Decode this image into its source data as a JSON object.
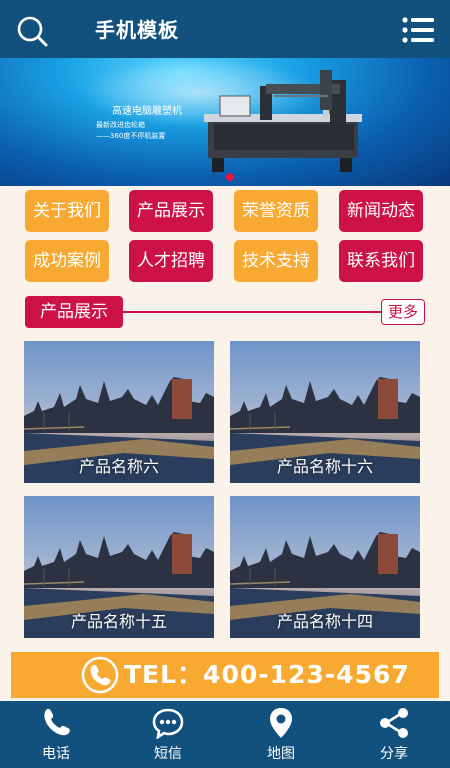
{
  "header": {
    "title": "手机模板",
    "search_icon": "search-icon",
    "menu_icon": "menu-icon"
  },
  "banner": {
    "line1": "高速电脑雕塑机",
    "line2": "最新改进齿轮箱",
    "line3": "——360度不停机装置",
    "slides": 2,
    "active_slide": 2
  },
  "nav": [
    {
      "label": "关于我们",
      "color": "#f8a932"
    },
    {
      "label": "产品展示",
      "color": "#cc1246"
    },
    {
      "label": "荣誉资质",
      "color": "#f8a932"
    },
    {
      "label": "新闻动态",
      "color": "#cc1246"
    },
    {
      "label": "成功案例",
      "color": "#f8a932"
    },
    {
      "label": "人才招聘",
      "color": "#cc1246"
    },
    {
      "label": "技术支持",
      "color": "#f8a932"
    },
    {
      "label": "联系我们",
      "color": "#cc1246"
    }
  ],
  "section": {
    "title": "产品展示",
    "more": "更多"
  },
  "products": [
    {
      "name": "产品名称六"
    },
    {
      "name": "产品名称十六"
    },
    {
      "name": "产品名称十五"
    },
    {
      "name": "产品名称十四"
    }
  ],
  "contact": {
    "tel": "TEL：400-123-4567",
    "icon": "phone-icon"
  },
  "footer": [
    {
      "label": "电话",
      "icon": "phone-icon"
    },
    {
      "label": "短信",
      "icon": "message-icon"
    },
    {
      "label": "地图",
      "icon": "map-pin-icon"
    },
    {
      "label": "分享",
      "icon": "share-icon"
    }
  ],
  "colors": {
    "primary": "#12517e",
    "accent_orange": "#f8a932",
    "accent_red": "#cc1246",
    "background": "#fbf3ea"
  }
}
